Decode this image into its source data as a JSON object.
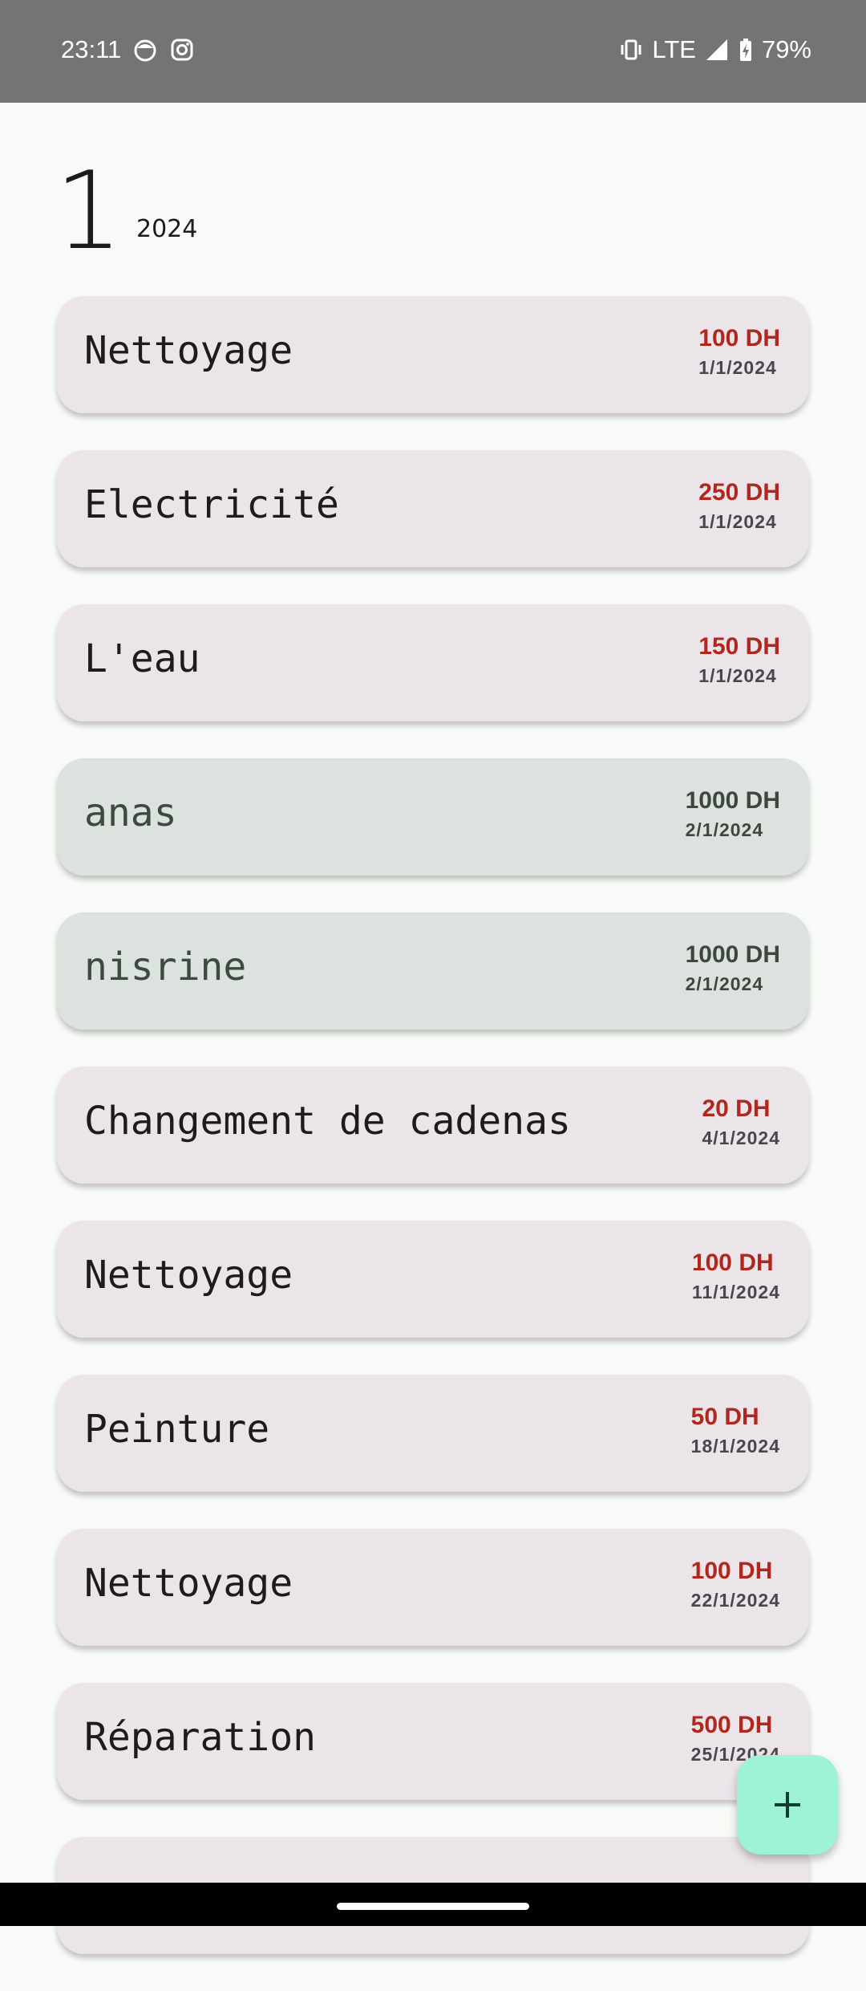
{
  "status_bar": {
    "time": "23:11",
    "network": "LTE",
    "battery": "79%",
    "icons": [
      "face-notification-icon",
      "instagram-icon",
      "vibrate-icon",
      "signal-icon",
      "battery-charging-icon"
    ]
  },
  "header": {
    "month": "1",
    "year": "2024"
  },
  "transactions": [
    {
      "title": "Nettoyage",
      "amount": "100 DH",
      "date": "1/1/2024",
      "type": "expense"
    },
    {
      "title": "Electricité",
      "amount": "250 DH",
      "date": "1/1/2024",
      "type": "expense"
    },
    {
      "title": "L'eau",
      "amount": "150 DH",
      "date": "1/1/2024",
      "type": "expense"
    },
    {
      "title": "anas",
      "amount": "1000 DH",
      "date": "2/1/2024",
      "type": "income"
    },
    {
      "title": "nisrine",
      "amount": "1000 DH",
      "date": "2/1/2024",
      "type": "income"
    },
    {
      "title": "Changement de cadenas",
      "amount": "20 DH",
      "date": "4/1/2024",
      "type": "expense"
    },
    {
      "title": "Nettoyage",
      "amount": "100 DH",
      "date": "11/1/2024",
      "type": "expense"
    },
    {
      "title": "Peinture",
      "amount": "50 DH",
      "date": "18/1/2024",
      "type": "expense"
    },
    {
      "title": "Nettoyage",
      "amount": "100 DH",
      "date": "22/1/2024",
      "type": "expense"
    },
    {
      "title": "Réparation",
      "amount": "500 DH",
      "date": "25/1/2024",
      "type": "expense"
    }
  ],
  "fab": {
    "icon": "plus-icon"
  },
  "colors": {
    "expense_amount": "#b3261e",
    "card_expense": "#ebe5ea",
    "card_income": "#dce3de",
    "fab": "#9ef2d5"
  }
}
